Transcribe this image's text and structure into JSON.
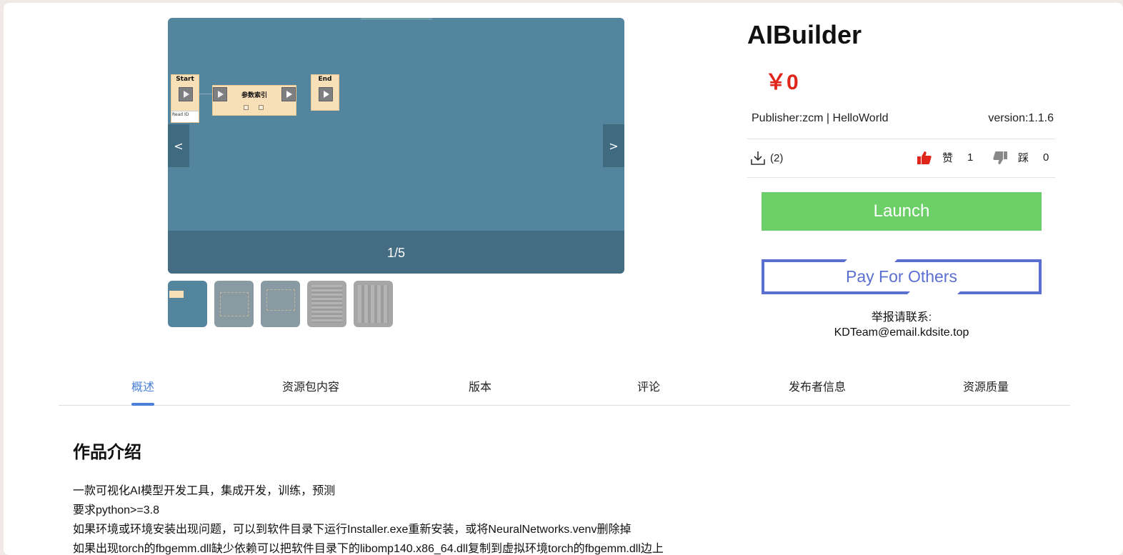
{
  "gallery": {
    "counter": "1/5",
    "prev_label": "<",
    "next_label": ">",
    "slide": {
      "start_label": "Start",
      "node_label": "参数索引",
      "end_label": "End",
      "start_sub": "Read ID"
    },
    "thumbnails": [
      {
        "name": "thumbnail-1",
        "active": true,
        "color": "#53869e"
      },
      {
        "name": "thumbnail-2",
        "active": false,
        "color": "#8a9aa3"
      },
      {
        "name": "thumbnail-3",
        "active": false,
        "color": "#8a9aa3"
      },
      {
        "name": "thumbnail-4",
        "active": false,
        "color": "#a6a6a6"
      },
      {
        "name": "thumbnail-5",
        "active": false,
        "color": "#a6a6a6"
      }
    ]
  },
  "product": {
    "title": "AIBuilder",
    "price": "￥0",
    "publisher": "Publisher:zcm | HelloWorld",
    "version": "version:1.1.6",
    "downloads": "(2)",
    "like_label": "赞",
    "like_count": "1",
    "dislike_label": "踩",
    "dislike_count": "0",
    "launch_label": "Launch",
    "pay_label": "Pay For Others",
    "report_label": "举报请联系:",
    "report_email": "KDTeam@email.kdsite.top"
  },
  "tabs": [
    {
      "label": "概述",
      "active": true
    },
    {
      "label": "资源包内容",
      "active": false
    },
    {
      "label": "版本",
      "active": false
    },
    {
      "label": "评论",
      "active": false
    },
    {
      "label": "发布者信息",
      "active": false
    },
    {
      "label": "资源质量",
      "active": false
    }
  ],
  "intro": {
    "title": "作品介绍",
    "lines": [
      "一款可视化AI模型开发工具，集成开发，训练，预测",
      "要求python>=3.8",
      "如果环境或环境安装出现问题，可以到软件目录下运行Installer.exe重新安装，或将NeuralNetworks.venv删除掉",
      "如果出现torch的fbgemm.dll缺少依赖可以把软件目录下的libomp140.x86_64.dll复制到虚拟环境torch的fbgemm.dll边上"
    ]
  },
  "colors": {
    "accent": "#4a7fd8",
    "price": "#e0251b",
    "launch": "#6dcf68",
    "pay_border": "#5b6fd0",
    "like": "#e0251b",
    "dislike": "#888888"
  }
}
